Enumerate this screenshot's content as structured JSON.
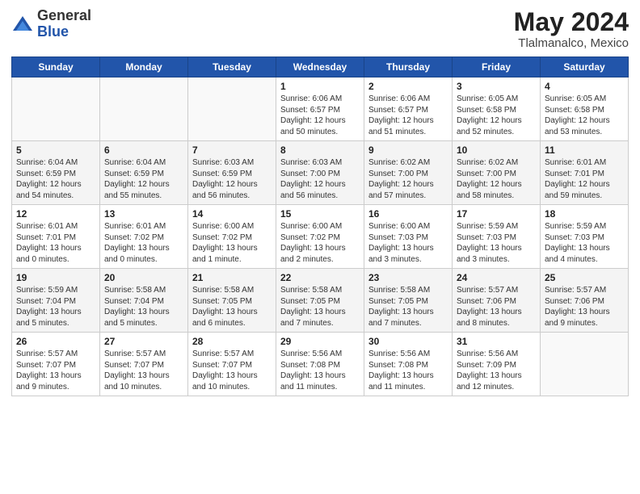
{
  "logo": {
    "general": "General",
    "blue": "Blue"
  },
  "header": {
    "title": "May 2024",
    "subtitle": "Tlalmanalco, Mexico"
  },
  "weekdays": [
    "Sunday",
    "Monday",
    "Tuesday",
    "Wednesday",
    "Thursday",
    "Friday",
    "Saturday"
  ],
  "weeks": [
    [
      {
        "day": "",
        "info": ""
      },
      {
        "day": "",
        "info": ""
      },
      {
        "day": "",
        "info": ""
      },
      {
        "day": "1",
        "info": "Sunrise: 6:06 AM\nSunset: 6:57 PM\nDaylight: 12 hours\nand 50 minutes."
      },
      {
        "day": "2",
        "info": "Sunrise: 6:06 AM\nSunset: 6:57 PM\nDaylight: 12 hours\nand 51 minutes."
      },
      {
        "day": "3",
        "info": "Sunrise: 6:05 AM\nSunset: 6:58 PM\nDaylight: 12 hours\nand 52 minutes."
      },
      {
        "day": "4",
        "info": "Sunrise: 6:05 AM\nSunset: 6:58 PM\nDaylight: 12 hours\nand 53 minutes."
      }
    ],
    [
      {
        "day": "5",
        "info": "Sunrise: 6:04 AM\nSunset: 6:59 PM\nDaylight: 12 hours\nand 54 minutes."
      },
      {
        "day": "6",
        "info": "Sunrise: 6:04 AM\nSunset: 6:59 PM\nDaylight: 12 hours\nand 55 minutes."
      },
      {
        "day": "7",
        "info": "Sunrise: 6:03 AM\nSunset: 6:59 PM\nDaylight: 12 hours\nand 56 minutes."
      },
      {
        "day": "8",
        "info": "Sunrise: 6:03 AM\nSunset: 7:00 PM\nDaylight: 12 hours\nand 56 minutes."
      },
      {
        "day": "9",
        "info": "Sunrise: 6:02 AM\nSunset: 7:00 PM\nDaylight: 12 hours\nand 57 minutes."
      },
      {
        "day": "10",
        "info": "Sunrise: 6:02 AM\nSunset: 7:00 PM\nDaylight: 12 hours\nand 58 minutes."
      },
      {
        "day": "11",
        "info": "Sunrise: 6:01 AM\nSunset: 7:01 PM\nDaylight: 12 hours\nand 59 minutes."
      }
    ],
    [
      {
        "day": "12",
        "info": "Sunrise: 6:01 AM\nSunset: 7:01 PM\nDaylight: 13 hours\nand 0 minutes."
      },
      {
        "day": "13",
        "info": "Sunrise: 6:01 AM\nSunset: 7:02 PM\nDaylight: 13 hours\nand 0 minutes."
      },
      {
        "day": "14",
        "info": "Sunrise: 6:00 AM\nSunset: 7:02 PM\nDaylight: 13 hours\nand 1 minute."
      },
      {
        "day": "15",
        "info": "Sunrise: 6:00 AM\nSunset: 7:02 PM\nDaylight: 13 hours\nand 2 minutes."
      },
      {
        "day": "16",
        "info": "Sunrise: 6:00 AM\nSunset: 7:03 PM\nDaylight: 13 hours\nand 3 minutes."
      },
      {
        "day": "17",
        "info": "Sunrise: 5:59 AM\nSunset: 7:03 PM\nDaylight: 13 hours\nand 3 minutes."
      },
      {
        "day": "18",
        "info": "Sunrise: 5:59 AM\nSunset: 7:03 PM\nDaylight: 13 hours\nand 4 minutes."
      }
    ],
    [
      {
        "day": "19",
        "info": "Sunrise: 5:59 AM\nSunset: 7:04 PM\nDaylight: 13 hours\nand 5 minutes."
      },
      {
        "day": "20",
        "info": "Sunrise: 5:58 AM\nSunset: 7:04 PM\nDaylight: 13 hours\nand 5 minutes."
      },
      {
        "day": "21",
        "info": "Sunrise: 5:58 AM\nSunset: 7:05 PM\nDaylight: 13 hours\nand 6 minutes."
      },
      {
        "day": "22",
        "info": "Sunrise: 5:58 AM\nSunset: 7:05 PM\nDaylight: 13 hours\nand 7 minutes."
      },
      {
        "day": "23",
        "info": "Sunrise: 5:58 AM\nSunset: 7:05 PM\nDaylight: 13 hours\nand 7 minutes."
      },
      {
        "day": "24",
        "info": "Sunrise: 5:57 AM\nSunset: 7:06 PM\nDaylight: 13 hours\nand 8 minutes."
      },
      {
        "day": "25",
        "info": "Sunrise: 5:57 AM\nSunset: 7:06 PM\nDaylight: 13 hours\nand 9 minutes."
      }
    ],
    [
      {
        "day": "26",
        "info": "Sunrise: 5:57 AM\nSunset: 7:07 PM\nDaylight: 13 hours\nand 9 minutes."
      },
      {
        "day": "27",
        "info": "Sunrise: 5:57 AM\nSunset: 7:07 PM\nDaylight: 13 hours\nand 10 minutes."
      },
      {
        "day": "28",
        "info": "Sunrise: 5:57 AM\nSunset: 7:07 PM\nDaylight: 13 hours\nand 10 minutes."
      },
      {
        "day": "29",
        "info": "Sunrise: 5:56 AM\nSunset: 7:08 PM\nDaylight: 13 hours\nand 11 minutes."
      },
      {
        "day": "30",
        "info": "Sunrise: 5:56 AM\nSunset: 7:08 PM\nDaylight: 13 hours\nand 11 minutes."
      },
      {
        "day": "31",
        "info": "Sunrise: 5:56 AM\nSunset: 7:09 PM\nDaylight: 13 hours\nand 12 minutes."
      },
      {
        "day": "",
        "info": ""
      }
    ]
  ]
}
